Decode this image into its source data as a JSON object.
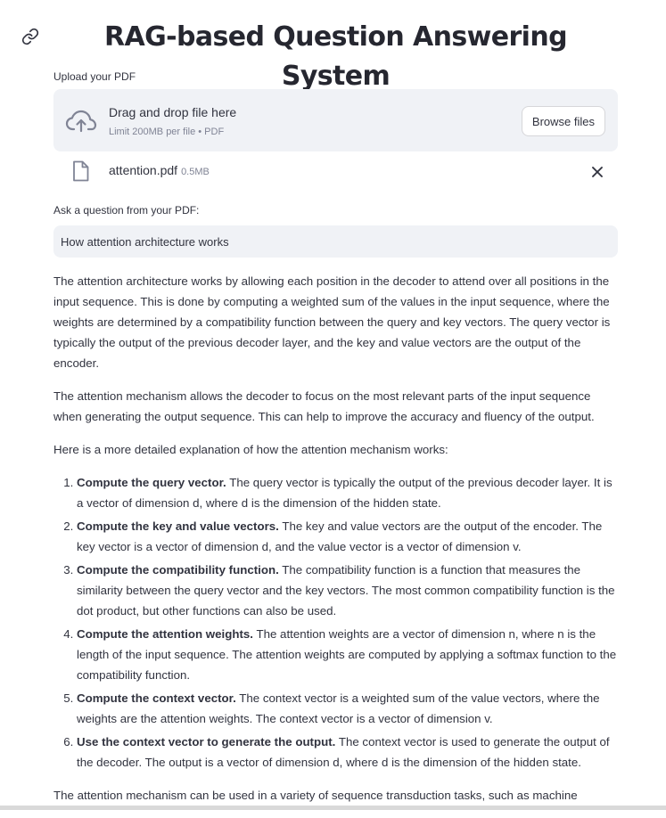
{
  "page": {
    "title": "RAG-based Question Answering System"
  },
  "uploader": {
    "label": "Upload your PDF",
    "dropzone_title": "Drag and drop file here",
    "dropzone_hint": "Limit 200MB per file • PDF",
    "browse_label": "Browse files",
    "file": {
      "name": "attention.pdf",
      "size": "0.5MB"
    }
  },
  "question": {
    "label": "Ask a question from your PDF:",
    "value": "How attention architecture works"
  },
  "answer": {
    "intro": "The attention architecture works by allowing each position in the decoder to attend over all positions in the input sequence. This is done by computing a weighted sum of the values in the input sequence, where the weights are determined by a compatibility function between the query and key vectors. The query vector is typically the output of the previous decoder layer, and the key and value vectors are the output of the encoder.",
    "mechanism": "The attention mechanism allows the decoder to focus on the most relevant parts of the input sequence when generating the output sequence. This can help to improve the accuracy and fluency of the output.",
    "lead_in": "Here is a more detailed explanation of how the attention mechanism works:",
    "steps": [
      {
        "title": "Compute the query vector.",
        "text": "The query vector is typically the output of the previous decoder layer. It is a vector of dimension d, where d is the dimension of the hidden state."
      },
      {
        "title": "Compute the key and value vectors.",
        "text": "The key and value vectors are the output of the encoder. The key vector is a vector of dimension d, and the value vector is a vector of dimension v."
      },
      {
        "title": "Compute the compatibility function.",
        "text": "The compatibility function is a function that measures the similarity between the query vector and the key vectors. The most common compatibility function is the dot product, but other functions can also be used."
      },
      {
        "title": "Compute the attention weights.",
        "text": "The attention weights are a vector of dimension n, where n is the length of the input sequence. The attention weights are computed by applying a softmax function to the compatibility function."
      },
      {
        "title": "Compute the context vector.",
        "text": "The context vector is a weighted sum of the value vectors, where the weights are the attention weights. The context vector is a vector of dimension v."
      },
      {
        "title": "Use the context vector to generate the output.",
        "text": "The context vector is used to generate the output of the decoder. The output is a vector of dimension d, where d is the dimension of the hidden state."
      }
    ],
    "closing": "The attention mechanism can be used in a variety of sequence transduction tasks, such as machine"
  },
  "icons": {
    "title_anchor": "link-icon",
    "dropzone": "cloud-upload-icon",
    "file": "file-icon",
    "remove": "close-icon"
  },
  "colors": {
    "text": "#31333f",
    "muted": "#808495",
    "field_background": "#f0f2f6",
    "button_border": "#d6d6d9"
  }
}
